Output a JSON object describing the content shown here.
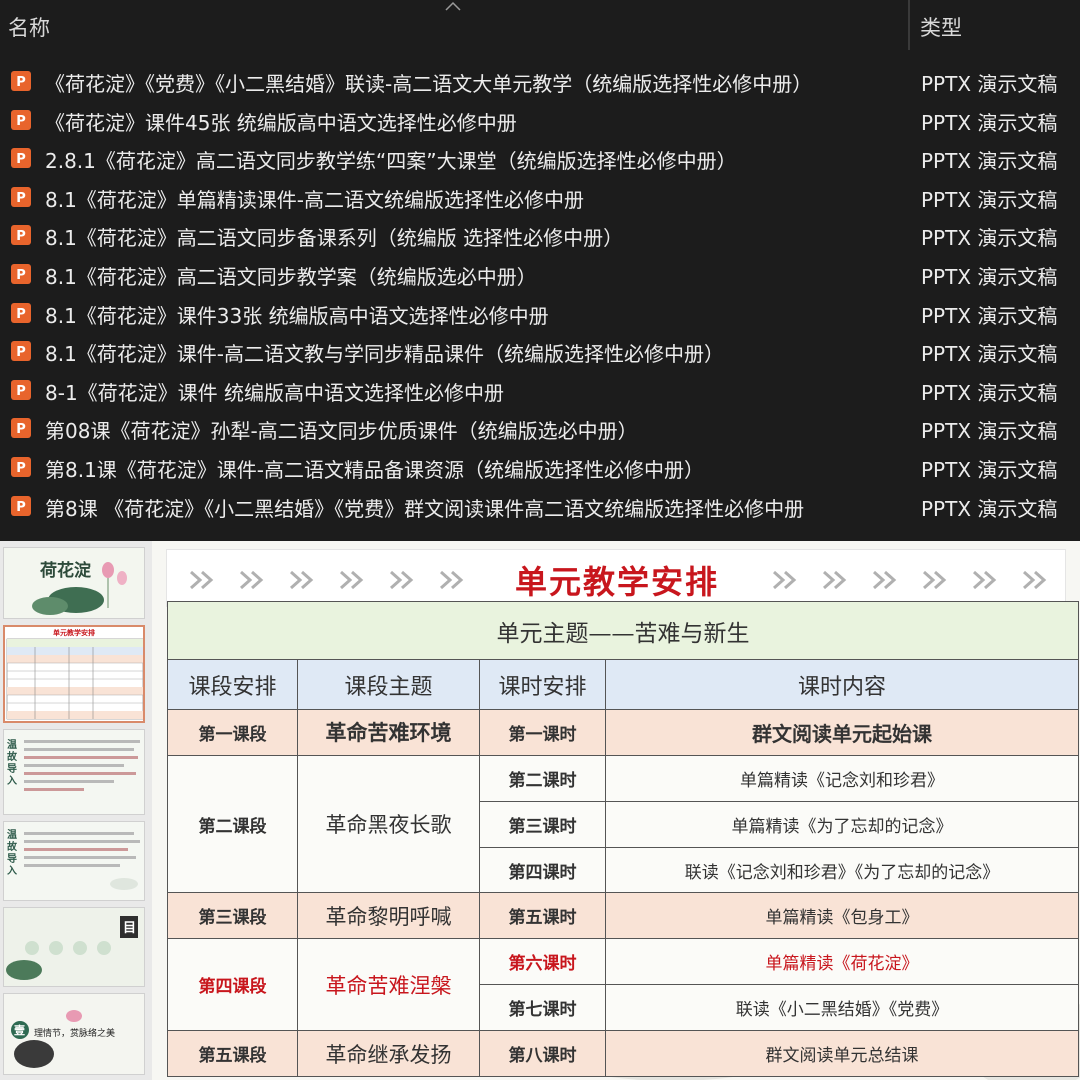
{
  "explorer": {
    "columns": {
      "name": "名称",
      "type": "类型"
    },
    "files": [
      {
        "name": "《荷花淀》《党费》《小二黑结婚》联读-高二语文大单元教学（统编版选择性必修中册）",
        "type": "PPTX 演示文稿"
      },
      {
        "name": "《荷花淀》课件45张 统编版高中语文选择性必修中册",
        "type": "PPTX 演示文稿"
      },
      {
        "name": "2.8.1《荷花淀》高二语文同步教学练“四案”大课堂（统编版选择性必修中册）",
        "type": "PPTX 演示文稿"
      },
      {
        "name": "8.1《荷花淀》单篇精读课件-高二语文统编版选择性必修中册",
        "type": "PPTX 演示文稿"
      },
      {
        "name": "8.1《荷花淀》高二语文同步备课系列（统编版 选择性必修中册）",
        "type": "PPTX 演示文稿"
      },
      {
        "name": "8.1《荷花淀》高二语文同步教学案（统编版选必中册）",
        "type": "PPTX 演示文稿"
      },
      {
        "name": "8.1《荷花淀》课件33张 统编版高中语文选择性必修中册",
        "type": "PPTX 演示文稿"
      },
      {
        "name": "8.1《荷花淀》课件-高二语文教与学同步精品课件（统编版选择性必修中册）",
        "type": "PPTX 演示文稿"
      },
      {
        "name": "8-1《荷花淀》课件 统编版高中语文选择性必修中册",
        "type": "PPTX 演示文稿"
      },
      {
        "name": "第08课《荷花淀》孙犁-高二语文同步优质课件（统编版选必中册）",
        "type": "PPTX 演示文稿"
      },
      {
        "name": "第8.1课《荷花淀》课件-高二语文精品备课资源（统编版选择性必修中册）",
        "type": "PPTX 演示文稿"
      },
      {
        "name": "第8课 《荷花淀》《小二黑结婚》《党费》群文阅读课件高二语文统编版选择性必修中册",
        "type": "PPTX 演示文稿"
      }
    ]
  },
  "thumbnails": {
    "t1_title": "荷花淀",
    "t2_title": "单元教学安排",
    "t3_side": "温故导入",
    "t4_side": "温故导入",
    "t5_mark": "目",
    "t6_mark": "壹",
    "t6_text": "理情节，赏脉络之美"
  },
  "slide": {
    "title": "单元教学安排",
    "unit_theme": "单元主题——苦难与新生",
    "headers": [
      "课段安排",
      "课段主题",
      "课时安排",
      "课时内容"
    ],
    "segments": [
      {
        "name": "第一课段",
        "theme": "革命苦难环境"
      },
      {
        "name": "第二课段",
        "theme": "革命黑夜长歌"
      },
      {
        "name": "第三课段",
        "theme": "革命黎明呼喊"
      },
      {
        "name": "第四课段",
        "theme": "革命苦难涅槃"
      },
      {
        "name": "第五课段",
        "theme": "革命继承发扬"
      }
    ],
    "lessons": [
      {
        "hour": "第一课时",
        "content": "群文阅读单元起始课"
      },
      {
        "hour": "第二课时",
        "content": "单篇精读《记念刘和珍君》"
      },
      {
        "hour": "第三课时",
        "content": "单篇精读《为了忘却的记念》"
      },
      {
        "hour": "第四课时",
        "content": "联读《记念刘和珍君》《为了忘却的记念》"
      },
      {
        "hour": "第五课时",
        "content": "单篇精读《包身工》"
      },
      {
        "hour": "第六课时",
        "content": "单篇精读《荷花淀》"
      },
      {
        "hour": "第七课时",
        "content": "联读《小二黑结婚》《党费》"
      },
      {
        "hour": "第八课时",
        "content": "群文阅读单元总结课"
      }
    ],
    "colors": {
      "title_red": "#c8161d",
      "theme_green": "#e9f3de",
      "header_blue": "#dfe9f5",
      "peach": "#f9e3d6"
    }
  }
}
